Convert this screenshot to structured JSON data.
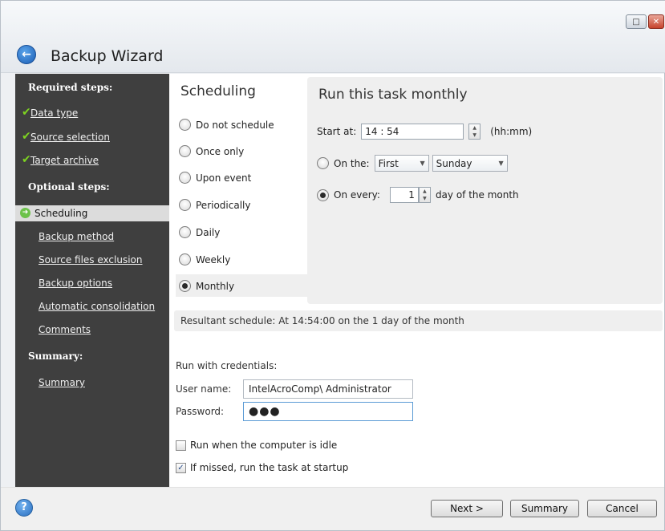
{
  "window": {
    "title": "Backup Wizard"
  },
  "window_controls": {
    "minimize": "□",
    "close": "✕"
  },
  "sidebar": {
    "required_heading": "Required steps:",
    "required_items": [
      {
        "label": "Data type"
      },
      {
        "label": "Source selection"
      },
      {
        "label": "Target archive"
      }
    ],
    "optional_heading": "Optional steps:",
    "selected_item": "Scheduling",
    "optional_items": [
      {
        "label": "Backup method"
      },
      {
        "label": "Source files exclusion"
      },
      {
        "label": "Backup options"
      },
      {
        "label": "Automatic consolidation"
      },
      {
        "label": "Comments"
      }
    ],
    "summary_heading": "Summary:",
    "summary_item": "Summary"
  },
  "scheduling": {
    "title": "Scheduling",
    "options": [
      {
        "label": "Do not schedule",
        "selected": false
      },
      {
        "label": "Once only",
        "selected": false
      },
      {
        "label": "Upon event",
        "selected": false
      },
      {
        "label": "Periodically",
        "selected": false
      },
      {
        "label": "Daily",
        "selected": false
      },
      {
        "label": "Weekly",
        "selected": false
      },
      {
        "label": "Monthly",
        "selected": true
      }
    ]
  },
  "monthly": {
    "title": "Run this task monthly",
    "start_label": "Start at:",
    "start_value": "14 : 54",
    "time_format": "(hh:mm)",
    "on_the_label": "On the:",
    "on_the_selected": false,
    "week_value": "First",
    "weekday_value": "Sunday",
    "on_every_label": "On every:",
    "on_every_selected": true,
    "day_value": "1",
    "day_suffix": "day of the month"
  },
  "resultant": {
    "label": "Resultant schedule:",
    "value": "At 14:54:00 on the 1 day of the month"
  },
  "credentials": {
    "heading": "Run with credentials:",
    "user_label": "User name:",
    "user_value": "IntelAcroComp\\ Administrator",
    "password_label": "Password:",
    "password_value": "●●●"
  },
  "checkboxes": [
    {
      "label": "Run when the computer is idle",
      "checked": false
    },
    {
      "label": "If missed, run the task at startup",
      "checked": true
    }
  ],
  "footer": {
    "help": "?",
    "next": "Next >",
    "summary": "Summary",
    "cancel": "Cancel"
  }
}
